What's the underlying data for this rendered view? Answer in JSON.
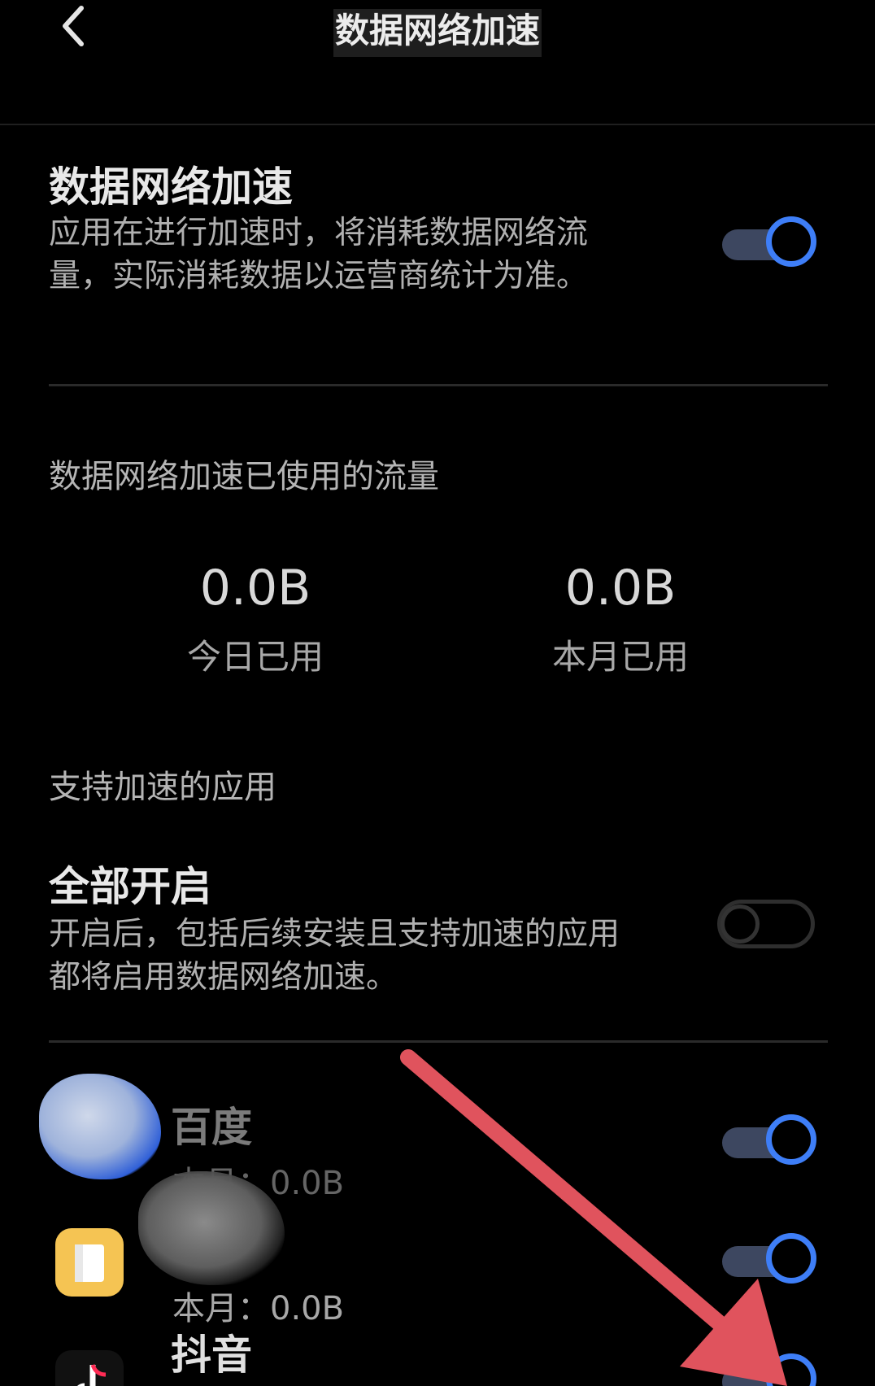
{
  "header": {
    "title": "数据网络加速",
    "back_icon": "chevron-left-icon"
  },
  "accel_setting": {
    "title": "数据网络加速",
    "description": "应用在进行加速时，将消耗数据网络流量，实际消耗数据以运营商统计为准。",
    "enabled": true
  },
  "usage": {
    "section_title": "数据网络加速已使用的流量",
    "today": {
      "value": "0.0B",
      "label": "今日已用"
    },
    "month": {
      "value": "0.0B",
      "label": "本月已用"
    }
  },
  "apps_section": {
    "title": "支持加速的应用",
    "all_on": {
      "title": "全部开启",
      "description": "开启后，包括后续安装且支持加速的应用都将启用数据网络加速。",
      "enabled": false
    },
    "apps": [
      {
        "name": "百度",
        "usage": "本月：0.0B",
        "enabled": true,
        "icon": "baidu-app-icon"
      },
      {
        "name": "",
        "usage": "本月：0.0B",
        "enabled": true,
        "icon": "book-app-icon"
      },
      {
        "name": "抖音",
        "usage": "",
        "enabled": true,
        "icon": "tiktok-app-icon"
      }
    ]
  },
  "colors": {
    "accent": "#3e7ef7",
    "annotation_arrow": "#e0535d",
    "background": "#000000"
  }
}
